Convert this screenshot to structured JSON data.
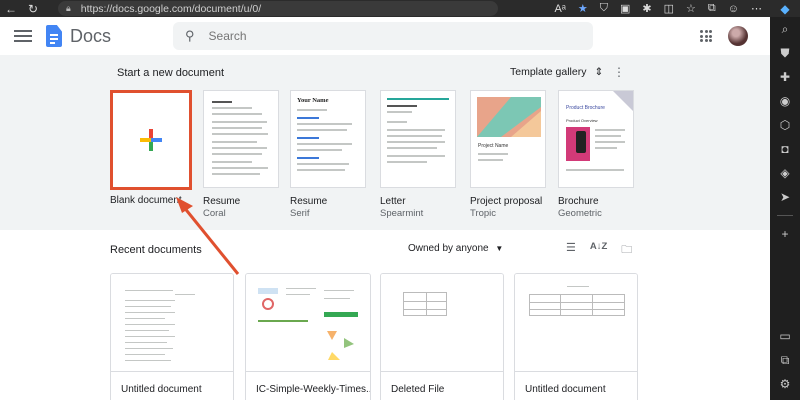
{
  "browser": {
    "url": "https://docs.google.com/document/u/0/",
    "read_aloud_label": "Aᵃ"
  },
  "header": {
    "app_title": "Docs",
    "search_placeholder": "Search"
  },
  "templates": {
    "section_title": "Start a new document",
    "gallery_label": "Template gallery",
    "items": [
      {
        "name": "Blank document",
        "sub": ""
      },
      {
        "name": "Resume",
        "sub": "Coral"
      },
      {
        "name": "Resume",
        "sub": "Serif"
      },
      {
        "name": "Letter",
        "sub": "Spearmint"
      },
      {
        "name": "Project proposal",
        "sub": "Tropic"
      },
      {
        "name": "Brochure",
        "sub": "Geometric"
      }
    ],
    "thumb_text": {
      "serif_name": "Your Name",
      "project_name": "Project Name",
      "brochure_title": "Product Brochure",
      "brochure_sub": "Product Overview"
    }
  },
  "recent": {
    "section_title": "Recent documents",
    "owned_filter": "Owned by anyone",
    "docs": [
      {
        "title": "Untitled document"
      },
      {
        "title": "IC-Simple-Weekly-Times..."
      },
      {
        "title": "Deleted File"
      },
      {
        "title": "Untitled document"
      }
    ]
  },
  "colors": {
    "highlight": "#e0502f",
    "docs_blue": "#4285f4"
  }
}
